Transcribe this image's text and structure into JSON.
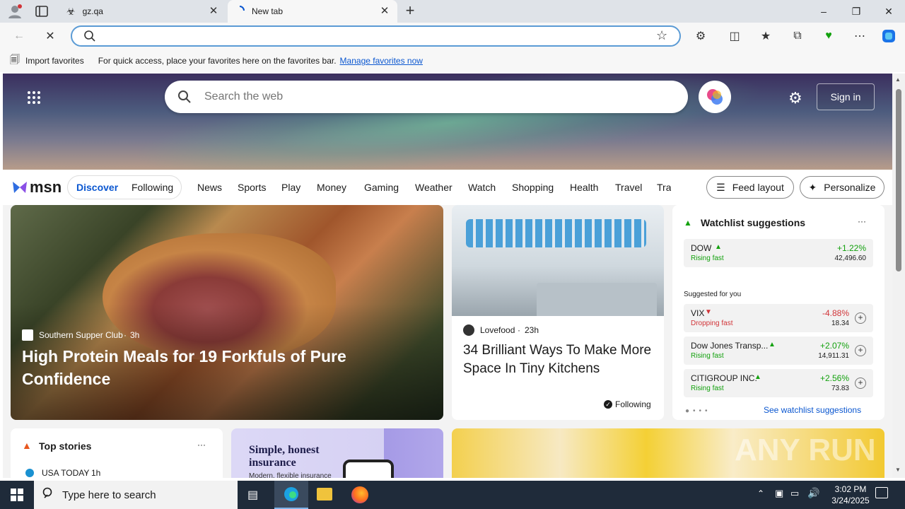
{
  "browser": {
    "tabs": [
      {
        "title": "gz.qa"
      },
      {
        "title": "New tab"
      }
    ],
    "address": {
      "value": "",
      "placeholder": ""
    },
    "favorites_bar": {
      "import_label": "Import favorites",
      "hint": "For quick access, place your favorites here on the favorites bar.",
      "manage_link": "Manage favorites now"
    }
  },
  "msn": {
    "search_placeholder": "Search the web",
    "signin": "Sign in",
    "logo": "msn",
    "pills": [
      "Discover",
      "Following"
    ],
    "nav": [
      "News",
      "Sports",
      "Play",
      "Money",
      "Gaming",
      "Weather",
      "Watch",
      "Shopping",
      "Health",
      "Travel",
      "Trai"
    ],
    "feed_layout": "Feed layout",
    "personalize": "Personalize",
    "main_story": {
      "source": "Southern Supper Club",
      "age": "3h",
      "headline": "High Protein Meals for 19 Forkfuls of Pure Confidence"
    },
    "kitchen_story": {
      "source": "Lovefood",
      "age": "23h",
      "headline": "34 Brilliant Ways To Make More Space In Tiny Kitchens",
      "following": "Following"
    },
    "watchlist": {
      "title": "Watchlist suggestions",
      "more": "···",
      "top": {
        "name": "DOW",
        "status": "Rising fast",
        "pct": "+1.22%",
        "value": "42,496.60"
      },
      "suggested_label": "Suggested for you",
      "items": [
        {
          "name": "VIX",
          "status": "Dropping fast",
          "pct": "-4.88%",
          "value": "18.34"
        },
        {
          "name": "Dow Jones Transp...",
          "status": "Rising fast",
          "pct": "+2.07%",
          "value": "14,911.31"
        },
        {
          "name": "CITIGROUP INC.",
          "status": "Rising fast",
          "pct": "+2.56%",
          "value": "73.83"
        }
      ],
      "see_link": "See watchlist suggestions"
    },
    "top_stories": {
      "title": "Top stories",
      "more": "···",
      "first_source": "USA TODAY",
      "first_age": "1h"
    },
    "ad": {
      "headline": "Simple, honest insurance",
      "sub": "Modern, flexible insurance"
    }
  },
  "taskbar": {
    "search_placeholder": "Type here to search",
    "time": "3:02 PM",
    "date": "3/24/2025"
  },
  "watermark": "ANY RUN",
  "colors": {
    "accent": "#0b57d0",
    "rising": "#13a10e",
    "falling": "#d13438",
    "taskbar": "#1f2b3a"
  }
}
